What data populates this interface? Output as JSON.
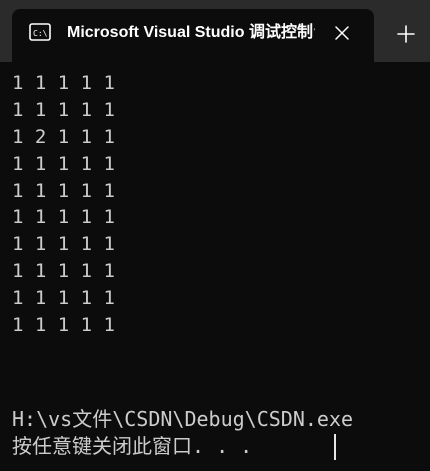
{
  "tab": {
    "title": "Microsoft Visual Studio 调试控制台",
    "icon": "console-app-icon",
    "close_icon": "close-icon",
    "new_tab_icon": "plus-icon"
  },
  "console": {
    "rows": [
      "1 1 1 1 1",
      "1 1 1 1 1",
      "1 2 1 1 1",
      "1 1 1 1 1",
      "1 1 1 1 1",
      "1 1 1 1 1",
      "1 1 1 1 1",
      "1 1 1 1 1",
      "1 1 1 1 1",
      "1 1 1 1 1"
    ],
    "exe_path": "H:\\vs文件\\CSDN\\Debug\\CSDN.exe",
    "prompt": "按任意键关闭此窗口. . ."
  },
  "colors": {
    "background": "#0c0c0c",
    "tab_strip": "#2b2b2b",
    "text": "#cccccc",
    "title_text": "#ffffff"
  }
}
